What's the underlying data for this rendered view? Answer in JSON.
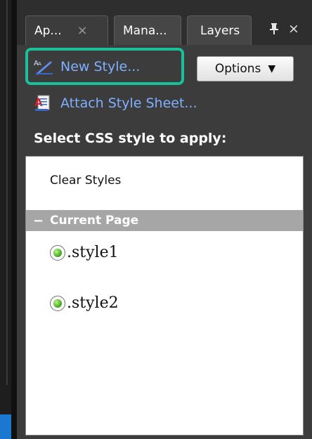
{
  "tabs": [
    {
      "label": "Ap...",
      "close": "×",
      "active": true
    },
    {
      "label": "Mana...",
      "active": false
    },
    {
      "label": "Layers",
      "active": false
    }
  ],
  "panel_controls": {
    "pin": "📌",
    "close": "×"
  },
  "toolbar": {
    "new_style_label": "New Style...",
    "options_label": "Options",
    "options_arrow": "▼",
    "attach_label": "Attach Style Sheet..."
  },
  "select_label": "Select CSS style to apply:",
  "list": {
    "clear_label": "Clear Styles",
    "group": {
      "toggle": "−",
      "label": "Current Page"
    },
    "styles": [
      ".style1",
      ".style2"
    ]
  },
  "colors": {
    "accent_highlight": "#19c09a",
    "link": "#7fb0ff",
    "panel_bg": "#3c3c3c",
    "group_header": "#a6a6a6"
  }
}
